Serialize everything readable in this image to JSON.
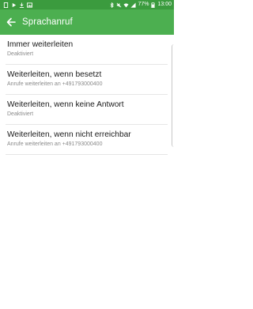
{
  "status_bar": {
    "battery": "77%",
    "time": "13:00",
    "left_icons": [
      "sim-icon",
      "play-icon",
      "download-icon",
      "image-icon"
    ],
    "right_icons": [
      "bluetooth-icon",
      "mute-icon",
      "wifi-icon",
      "signal-icon",
      "battery-icon"
    ]
  },
  "app_bar": {
    "title": "Sprachanruf",
    "back_icon": "arrow-left-icon"
  },
  "settings": [
    {
      "title": "Immer weiterleiten",
      "subtitle": "Deaktiviert"
    },
    {
      "title": "Weiterleiten, wenn besetzt",
      "subtitle": "Anrufe weiterleiten an +491793000400"
    },
    {
      "title": "Weiterleiten, wenn keine Antwort",
      "subtitle": "Deaktiviert"
    },
    {
      "title": "Weiterleiten, wenn nicht erreichbar",
      "subtitle": "Anrufe weiterleiten an +491793000400"
    }
  ],
  "colors": {
    "status_bar": "#3b9b3e",
    "app_bar": "#4caf50",
    "title_text": "#1a1a1a",
    "subtitle_text": "#8a8a8a"
  }
}
